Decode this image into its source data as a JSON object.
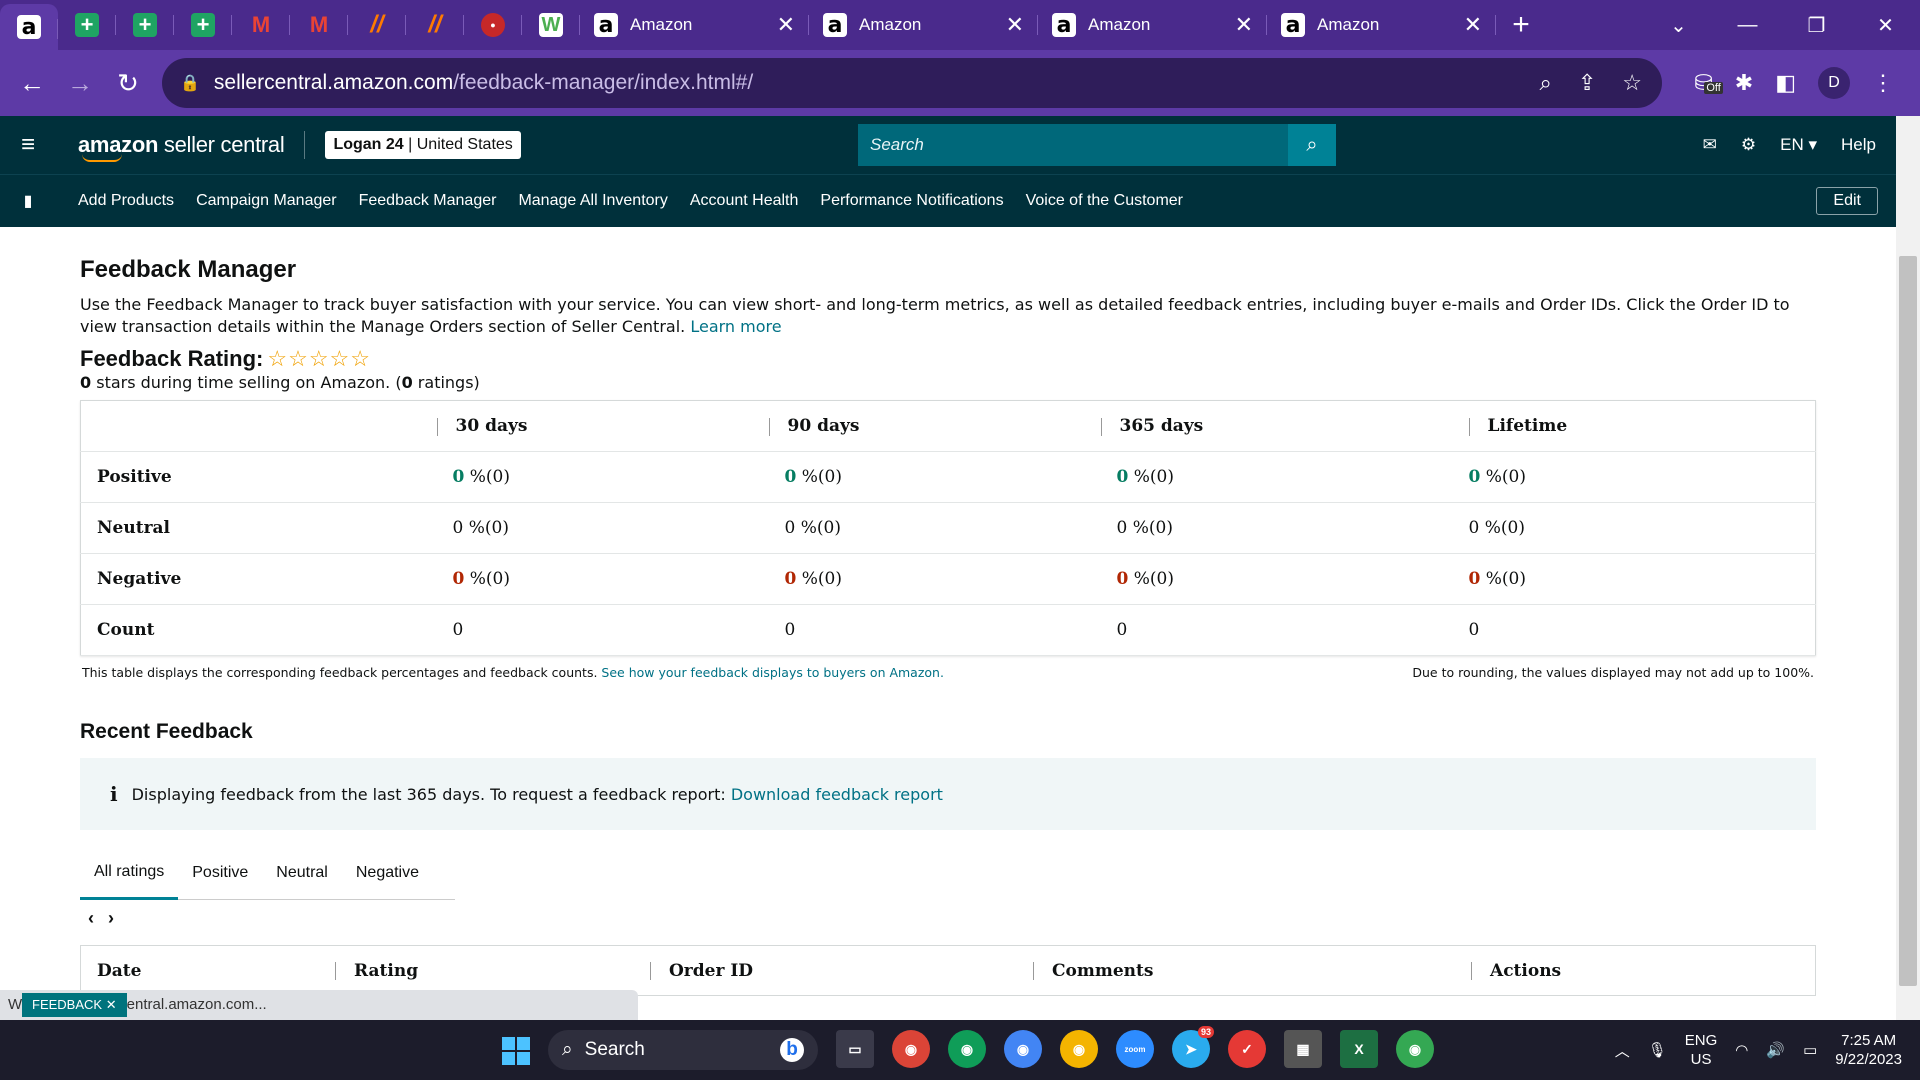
{
  "browser": {
    "pinned_tabs": [
      {
        "name": "amazon-tab-favicon",
        "glyph": "a",
        "cls": "fav-amazon"
      },
      {
        "name": "sheets-tab-favicon",
        "glyph": "+",
        "cls": "fav-sheets"
      },
      {
        "name": "sheets-tab-favicon",
        "glyph": "+",
        "cls": "fav-sheets"
      },
      {
        "name": "sheets-tab-favicon",
        "glyph": "+",
        "cls": "fav-sheets"
      },
      {
        "name": "gmail-tab-favicon",
        "glyph": "M",
        "cls": "fav-gmail"
      },
      {
        "name": "gmail-tab-favicon",
        "glyph": "M",
        "cls": "fav-gmail"
      },
      {
        "name": "slash-tab-favicon",
        "glyph": "//",
        "cls": "fav-slash"
      },
      {
        "name": "slash-tab-favicon",
        "glyph": "//",
        "cls": "fav-slash"
      },
      {
        "name": "red-app-tab-favicon",
        "glyph": "●",
        "cls": "fav-red"
      },
      {
        "name": "w-app-tab-favicon",
        "glyph": "W",
        "cls": "fav-w"
      }
    ],
    "tabs": [
      {
        "title": "Amazon"
      },
      {
        "title": "Amazon"
      },
      {
        "title": "Amazon"
      },
      {
        "title": "Amazon"
      }
    ],
    "url_host": "sellercentral.amazon.com",
    "url_path": "/feedback-manager/index.html#/",
    "profile_initial": "D",
    "extension_badge": "Off"
  },
  "header": {
    "logo_bold": "amazon",
    "logo_rest": " seller central",
    "store_name": "Logan 24",
    "store_region": "United States",
    "search_placeholder": "Search",
    "lang": "EN",
    "help": "Help"
  },
  "nav": {
    "items": [
      "Add Products",
      "Campaign Manager",
      "Feedback Manager",
      "Manage All Inventory",
      "Account Health",
      "Performance Notifications",
      "Voice of the Customer"
    ],
    "edit": "Edit"
  },
  "page": {
    "title": "Feedback Manager",
    "description": "Use the Feedback Manager to track buyer satisfaction with your service. You can view short- and long-term metrics, as well as detailed feedback entries, including buyer e-mails and Order IDs. Click the Order ID to view transaction details within the Manage Orders section of Seller Central.",
    "learn_more": "Learn more",
    "rating_label": "Feedback Rating:",
    "stars": "☆☆☆☆☆",
    "stars_count": "0",
    "stars_text_mid": " stars during time selling on Amazon. (",
    "ratings_count": "0",
    "stars_text_end": " ratings)"
  },
  "feedback_table": {
    "columns": [
      "30 days",
      "90 days",
      "365 days",
      "Lifetime"
    ],
    "rows": [
      {
        "label": "Positive",
        "kind": "pos",
        "cells": [
          [
            "0",
            " %(0)"
          ],
          [
            "0",
            " %(0)"
          ],
          [
            "0",
            " %(0)"
          ],
          [
            "0",
            " %(0)"
          ]
        ]
      },
      {
        "label": "Neutral",
        "kind": "neu",
        "cells": [
          [
            "0",
            " %(0)"
          ],
          [
            "0",
            " %(0)"
          ],
          [
            "0",
            " %(0)"
          ],
          [
            "0",
            " %(0)"
          ]
        ]
      },
      {
        "label": "Negative",
        "kind": "neg",
        "cells": [
          [
            "0",
            " %(0)"
          ],
          [
            "0",
            " %(0)"
          ],
          [
            "0",
            " %(0)"
          ],
          [
            "0",
            " %(0)"
          ]
        ]
      },
      {
        "label": "Count",
        "kind": "plain",
        "cells": [
          [
            "0",
            ""
          ],
          [
            "0",
            ""
          ],
          [
            "0",
            ""
          ],
          [
            "0",
            ""
          ]
        ]
      }
    ],
    "footnote_left": "This table displays the corresponding feedback percentages and feedback counts.",
    "footnote_link": "See how your feedback displays to buyers on Amazon.",
    "footnote_right": "Due to rounding, the values displayed may not add up to 100%."
  },
  "recent": {
    "title": "Recent Feedback",
    "alert_text": "Displaying feedback from the last 365 days. To request a feedback report:",
    "alert_link": "Download feedback report",
    "tabs": [
      "All ratings",
      "Positive",
      "Neutral",
      "Negative"
    ],
    "columns": [
      "Date",
      "Rating",
      "Order ID",
      "Comments",
      "Actions"
    ]
  },
  "status_bar": {
    "text": "Waiting for sellercentral.amazon.com...",
    "feedback_badge": "FEEDBACK"
  },
  "taskbar": {
    "search": "Search",
    "lang_top": "ENG",
    "lang_bottom": "US",
    "time": "7:25 AM",
    "date": "9/22/2023",
    "telegram_badge": "93"
  }
}
